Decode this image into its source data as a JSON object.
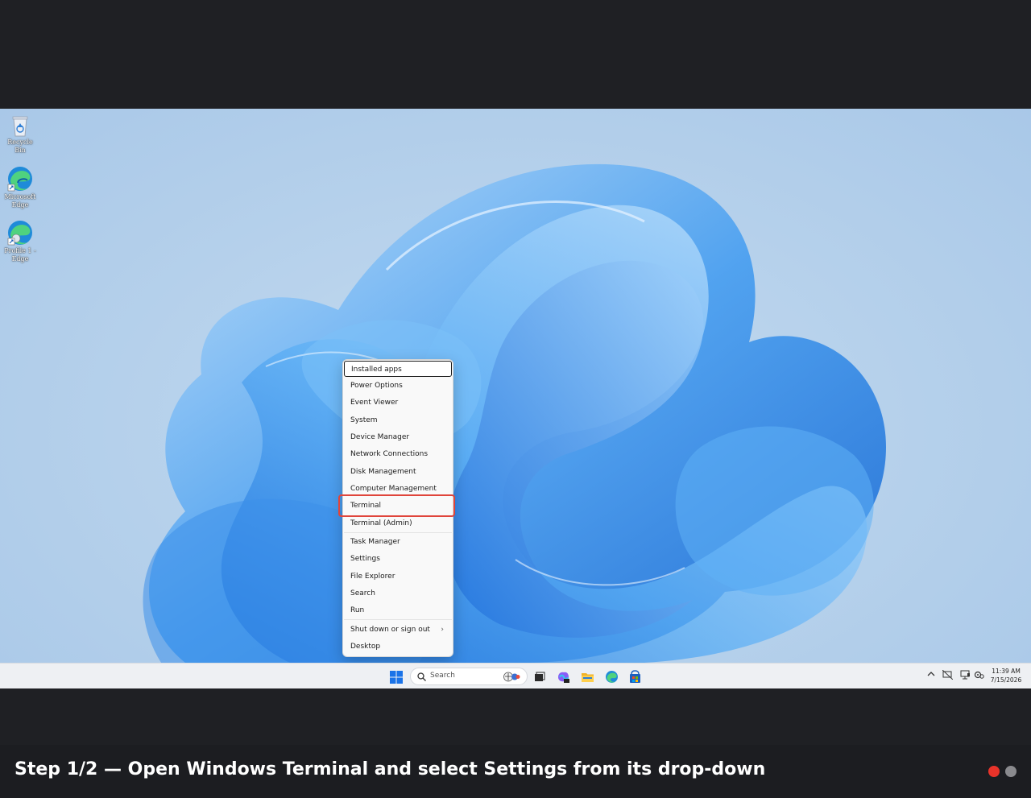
{
  "desktop": {
    "icons": [
      {
        "label": "Recycle Bin",
        "icon": "recycle-bin-icon"
      },
      {
        "label": "Microsoft Edge",
        "icon": "edge-icon"
      },
      {
        "label": "Profile 1 - Edge",
        "icon": "edge-profile-icon"
      }
    ]
  },
  "menu": {
    "items": [
      "Installed apps",
      "Power Options",
      "Event Viewer",
      "System",
      "Device Manager",
      "Network Connections",
      "Disk Management",
      "Computer Management",
      "Terminal",
      "Terminal (Admin)",
      "Task Manager",
      "Settings",
      "File Explorer",
      "Search",
      "Run",
      "Shut down or sign out",
      "Desktop"
    ],
    "focused_item": "Installed apps",
    "highlighted_item": "Terminal",
    "submenu_chevron": "›"
  },
  "taskbar": {
    "search_placeholder": "Search",
    "apps": [
      "start-icon",
      "task-view-icon",
      "copilot-icon",
      "file-explorer-icon",
      "edge-icon",
      "store-icon"
    ],
    "tray_icons": [
      "chevron-up-icon",
      "network-off-icon",
      "display-icon",
      "settings-badge-icon"
    ],
    "time": "11:39 AM",
    "date": "7/15/2026"
  },
  "caption": {
    "text": "Step 1/2 — Open Windows Terminal and select Settings from its drop-down",
    "step_dots": [
      {
        "state": "active",
        "color": "#e8332a"
      },
      {
        "state": "inactive",
        "color": "#8a8a8e"
      }
    ]
  },
  "colors": {
    "highlight": "#e0453b",
    "background": "#1f2024"
  }
}
